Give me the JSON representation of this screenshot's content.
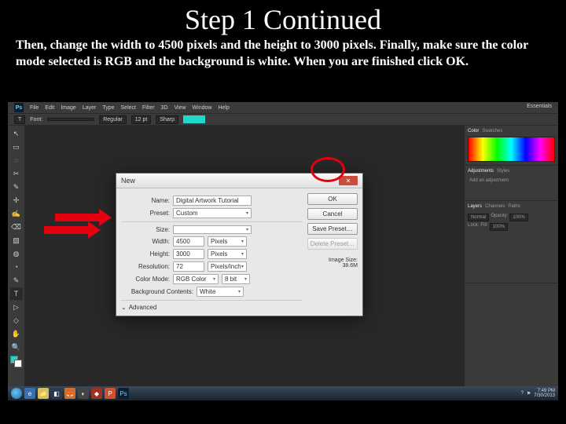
{
  "slide": {
    "title": "Step 1 Continued",
    "body": "Then, change the width to 4500 pixels and the height to 3000 pixels. Finally, make sure the color mode selected is RGB and the background is white. When you are finished click OK."
  },
  "ps": {
    "menubar": [
      "File",
      "Edit",
      "Image",
      "Layer",
      "Type",
      "Select",
      "Filter",
      "3D",
      "View",
      "Window",
      "Help"
    ],
    "header_right": "Essentials",
    "optbar": {
      "tool_glyph": "T",
      "font_label": "Font:",
      "font_value": "",
      "style": "Regular",
      "size": "12 pt",
      "aa": "Sharp"
    },
    "toolbox": [
      "↖",
      "▭",
      "◌",
      "✂",
      "✎",
      "✢",
      "✍",
      "⌫",
      "▨",
      "◍",
      "◔",
      "✎",
      "T",
      "▷",
      "◇",
      "✋",
      "🔍"
    ]
  },
  "panels": {
    "color_tabs": [
      "Color",
      "Swatches"
    ],
    "adjust_tabs": [
      "Adjustments",
      "Styles"
    ],
    "adjust_hint": "Add an adjustment",
    "layers_tabs": [
      "Layers",
      "Channels",
      "Paths"
    ],
    "layers_mode": "Normal",
    "layers_opacity_label": "Opacity:",
    "layers_opacity": "100%",
    "layers_lock": "Lock:",
    "layers_fill_label": "Fill:",
    "layers_fill": "100%"
  },
  "dialog": {
    "title": "New",
    "name_label": "Name:",
    "name_value": "Digital Artwork Tutorial",
    "preset_label": "Preset:",
    "preset_value": "Custom",
    "size_label": "Size:",
    "size_value": "",
    "width_label": "Width:",
    "width_value": "4500",
    "width_unit": "Pixels",
    "height_label": "Height:",
    "height_value": "3000",
    "height_unit": "Pixels",
    "res_label": "Resolution:",
    "res_value": "72",
    "res_unit": "Pixels/Inch",
    "mode_label": "Color Mode:",
    "mode_value": "RGB Color",
    "mode_depth": "8 bit",
    "bg_label": "Background Contents:",
    "bg_value": "White",
    "advanced": "Advanced",
    "image_size_label": "Image Size:",
    "image_size_value": "38.6M",
    "btn_ok": "OK",
    "btn_cancel": "Cancel",
    "btn_save": "Save Preset…",
    "btn_delete": "Delete Preset…"
  },
  "taskbar": {
    "time": "7:49 PM",
    "date": "7/30/2013"
  }
}
